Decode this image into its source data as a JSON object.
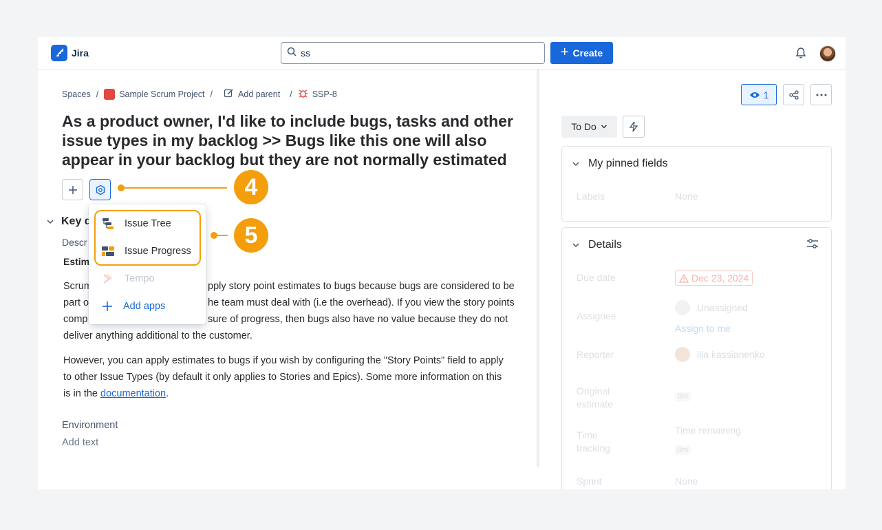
{
  "app": {
    "name": "Jira"
  },
  "search": {
    "value": "ss"
  },
  "header": {
    "create_label": "Create"
  },
  "breadcrumb": {
    "spaces": "Spaces",
    "sep": "/",
    "project": "Sample Scrum Project",
    "add_parent": "Add parent",
    "issue_key": "SSP-8"
  },
  "issue": {
    "title": "As a product owner, I'd like to include bugs, tasks and other issue types in my backlog >> Bugs like this one will also appear in your backlog but they are not normally estimated"
  },
  "callouts": {
    "first": "4",
    "second": "5"
  },
  "dropdown": {
    "items": [
      {
        "label": "Issue Tree",
        "icon": "issue-tree-icon"
      },
      {
        "label": "Issue Progress",
        "icon": "issue-progress-icon"
      },
      {
        "label": "Tempo",
        "icon": "tempo-icon"
      },
      {
        "label": "Add apps",
        "icon": "plus-icon"
      }
    ]
  },
  "content": {
    "key_section": "Key d",
    "description_label": "Descr",
    "estimation_label": "Estim",
    "para1_lines": [
      {
        "left": "Scrum",
        "right": "pply story point estimates to bugs because bugs are considered to be"
      },
      {
        "left": "part o",
        "right": "he team must deal with (i.e the overhead). If you view the story points"
      },
      {
        "left": "comp",
        "right": "sure of progress, then bugs also have no value because they do not"
      }
    ],
    "para1_last": "deliver anything additional to the customer.",
    "para2_lines": [
      "However, you can apply estimates to bugs if you wish by configuring the \"Story Points\" field to apply",
      "to other Issue Types (by default it only applies to Stories and Epics). Some more information on this"
    ],
    "para2_last_prefix": "is in the ",
    "para2_link": "documentation",
    "para2_last_suffix": ".",
    "environment_label": "Environment",
    "environment_placeholder": "Add text"
  },
  "sidebar": {
    "watchers_count": "1",
    "status": "To Do",
    "pinned": {
      "title": "My pinned fields",
      "labels_label": "Labels",
      "labels_value": "None"
    },
    "details": {
      "title": "Details",
      "due_date_label": "Due date",
      "due_date_value": "Dec 23, 2024",
      "assignee_label": "Assignee",
      "assignee_value": "Unassigned",
      "assign_to_me": "Assign to me",
      "reporter_label": "Reporter",
      "reporter_value": "ilia kassianenko",
      "original_estimate_label_1": "Original",
      "original_estimate_label_2": "estimate",
      "original_estimate_value": "0m",
      "time_tracking_label_1": "Time",
      "time_tracking_label_2": "tracking",
      "time_remaining": "Time remaining",
      "time_tracking_value": "0m",
      "sprint_label": "Sprint",
      "sprint_value": "None"
    }
  },
  "colors": {
    "brand": "#1868db",
    "callout": "#f59e0b",
    "bug": "#e2483d"
  }
}
